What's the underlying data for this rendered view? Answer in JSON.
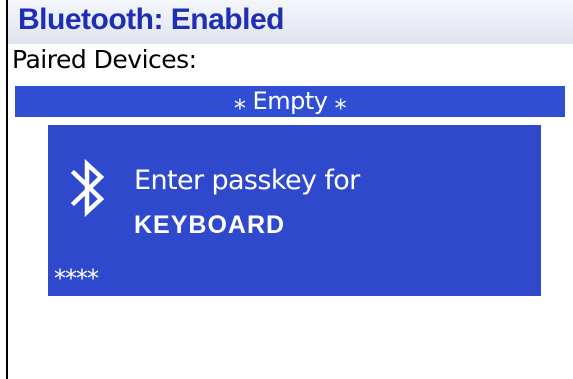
{
  "header": {
    "title": "Bluetooth: Enabled"
  },
  "paired_devices": {
    "label": "Paired Devices:",
    "empty_item": "⁎ Empty ⁎"
  },
  "dialog": {
    "icon": "bluetooth-icon",
    "prompt": "Enter passkey for",
    "device_name": "KEYBOARD",
    "passkey_value": "⁎⁎⁎⁎"
  },
  "colors": {
    "title_text": "#1f2fb4",
    "selection_bar": "#2f4ed3",
    "dialog_background": "#2f49cc",
    "dialog_text": "#ffffff"
  }
}
